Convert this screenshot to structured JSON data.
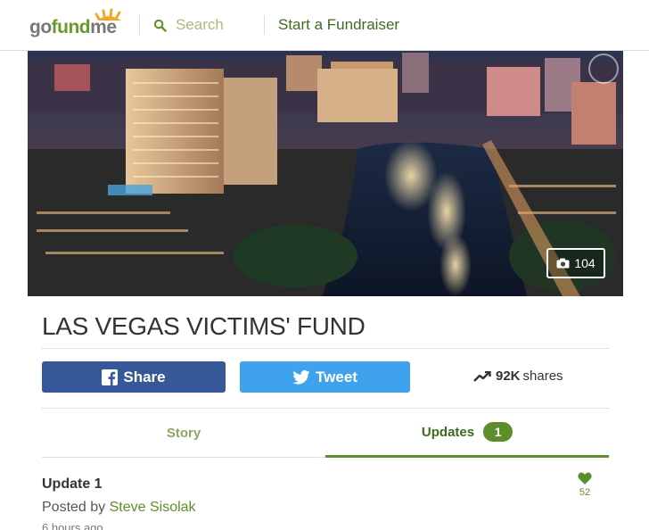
{
  "header": {
    "logo": {
      "part1": "go",
      "part2": "fund",
      "part3": "me"
    },
    "search": {
      "placeholder": "Search",
      "value": ""
    },
    "start_link": "Start a Fundraiser"
  },
  "hero": {
    "photo_count": "104",
    "icons": {
      "camera": "camera-icon",
      "chart_overlay": "chart-icon"
    }
  },
  "campaign": {
    "title": "LAS VEGAS VICTIMS' FUND",
    "share_label": "Share",
    "tweet_label": "Tweet",
    "shares_count": "92K",
    "shares_label": "shares"
  },
  "tabs": [
    {
      "label": "Story"
    },
    {
      "label": "Updates",
      "badge": "1"
    }
  ],
  "update": {
    "title": "Update 1",
    "posted_prefix": "Posted by",
    "author": "Steve Sisolak",
    "time": "6 hours ago",
    "likes": "52"
  },
  "colors": {
    "brand_green": "#5e8e2a",
    "facebook_blue": "#365899",
    "twitter_blue": "#3fa2ec"
  }
}
